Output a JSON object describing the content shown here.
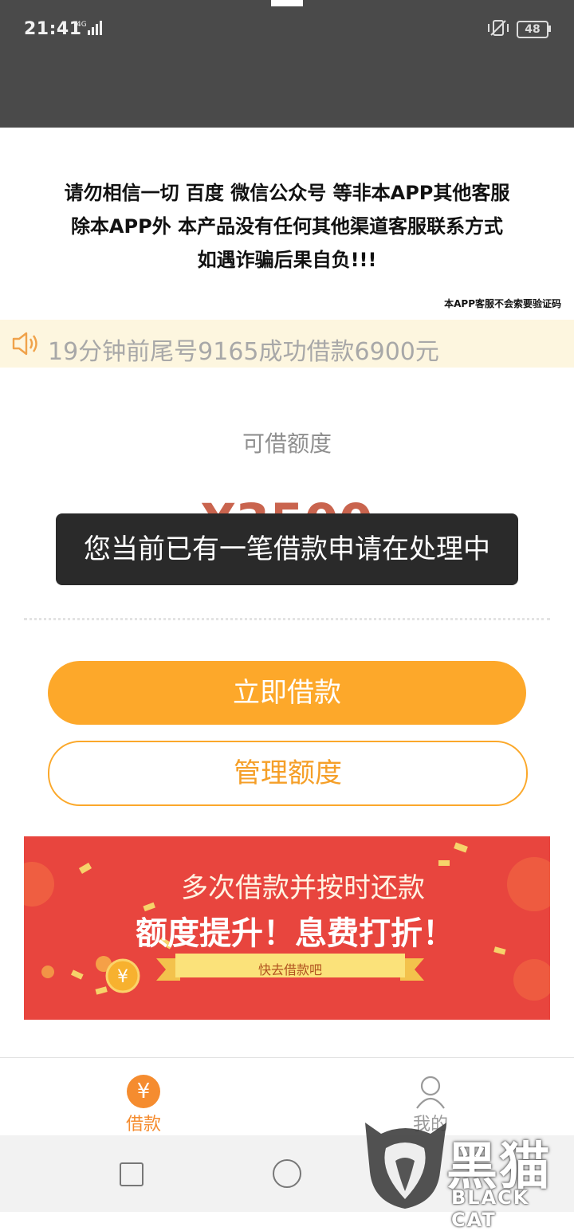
{
  "status_bar": {
    "time": "21:41",
    "battery": "48"
  },
  "notice": {
    "line1": "请勿相信一切 百度 微信公众号 等非本APP其他客服",
    "line2": "除本APP外 本产品没有任何其他渠道客服联系方式",
    "line3": "如遇诈骗后果自负!!!",
    "small": "本APP客服不会索要验证码"
  },
  "marquee": {
    "text": "19分钟前尾号9165成功借款6900元",
    "icon": "speaker-icon"
  },
  "credit": {
    "label": "可借额度",
    "amount": "¥3500"
  },
  "toast": {
    "text": "您当前已有一笔借款申请在处理中"
  },
  "buttons": {
    "borrow": "立即借款",
    "manage": "管理额度"
  },
  "banner": {
    "line1": "多次借款并按时还款",
    "line2": "额度提升！息费打折！",
    "ribbon": "快去借款吧"
  },
  "tabs": [
    {
      "label": "借款",
      "icon": "yen-icon",
      "glyph": "¥",
      "active": true
    },
    {
      "label": "我的",
      "icon": "person-icon",
      "active": false
    }
  ],
  "watermark": {
    "cn": "黑猫",
    "en": "BLACK CAT"
  },
  "colors": {
    "accent": "#fda82a",
    "tab_active": "#f58c2f",
    "banner_bg": "#e8453e",
    "marquee_bg": "#fdf6df",
    "header_bg": "#4a4a4a"
  }
}
